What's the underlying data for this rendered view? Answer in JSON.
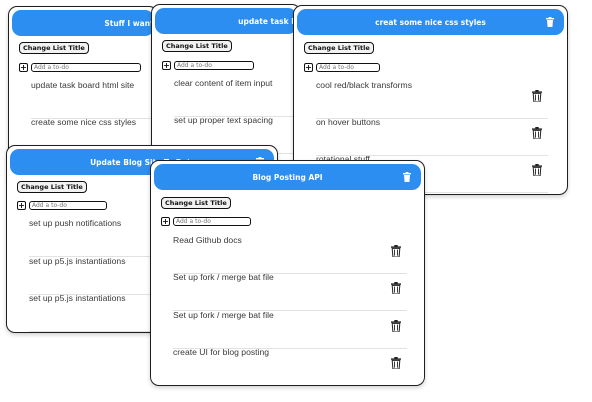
{
  "lists": [
    {
      "title": "Stuff I want",
      "change_label": "Change List Title",
      "placeholder": "Add a to-do",
      "plus": "+",
      "items": [
        "update task board html site",
        "create some nice css styles"
      ]
    },
    {
      "title": "update task board",
      "change_label": "Change List Title",
      "placeholder": "Add a to-do",
      "plus": "+",
      "items": [
        "clear content of item input",
        "set up proper text spacing"
      ]
    },
    {
      "title": "creat some nice css styles",
      "change_label": "Change List Title",
      "placeholder": "Add a to-do",
      "plus": "+",
      "items": [
        "cool red/black transforms",
        "on hover buttons",
        "rotational stuff"
      ]
    },
    {
      "title": "Update Blog Site To Do's",
      "change_label": "Change List Title",
      "placeholder": "Add a to-do",
      "plus": "+",
      "items": [
        "set up push notifications",
        "set up p5.js instantiations",
        "set up p5.js instantiations"
      ]
    },
    {
      "title": "Blog Posting API",
      "change_label": "Change List Title",
      "placeholder": "Add a to-do",
      "plus": "+",
      "items": [
        "Read Github docs",
        "Set up fork / merge bat file",
        "Set up fork / merge bat file",
        "create UI for blog posting"
      ]
    }
  ],
  "colors": {
    "header": "#2b8ef0",
    "border": "#1f1f1f"
  },
  "icons": {
    "delete": "trash-icon"
  }
}
